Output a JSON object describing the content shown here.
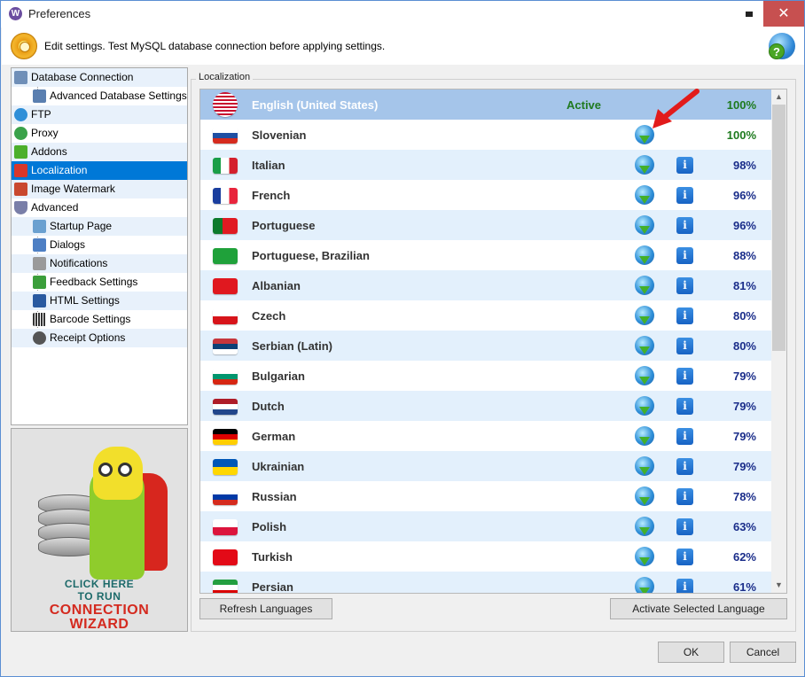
{
  "window": {
    "title": "Preferences"
  },
  "infobar": {
    "text": "Edit settings. Test MySQL database connection before applying settings."
  },
  "sidebar": {
    "items": [
      {
        "label": "Database Connection",
        "icon": "database-icon",
        "color": "#6f8fb8"
      },
      {
        "label": "Advanced Database Settings",
        "icon": "database-settings-icon",
        "color": "#5a7fb0"
      },
      {
        "label": "FTP",
        "icon": "ftp-globe-icon",
        "color": "#2f8fd8"
      },
      {
        "label": "Proxy",
        "icon": "proxy-icon",
        "color": "#3aa24a"
      },
      {
        "label": "Addons",
        "icon": "puzzle-icon",
        "color": "#4caf2a"
      },
      {
        "label": "Localization",
        "icon": "localization-flag-icon",
        "color": "#d9372a"
      },
      {
        "label": "Image Watermark",
        "icon": "image-watermark-icon",
        "color": "#c9482e"
      },
      {
        "label": "Advanced",
        "icon": "shield-icon",
        "color": "#7a7fa8"
      },
      {
        "label": "Startup Page",
        "icon": "startup-page-icon",
        "color": "#6aa0d0"
      },
      {
        "label": "Dialogs",
        "icon": "dialogs-icon",
        "color": "#4d7fc4"
      },
      {
        "label": "Notifications",
        "icon": "notifications-icon",
        "color": "#9a9a9a"
      },
      {
        "label": "Feedback Settings",
        "icon": "feedback-chart-icon",
        "color": "#3b9e3b"
      },
      {
        "label": "HTML Settings",
        "icon": "html-icon",
        "color": "#2a5aa0"
      },
      {
        "label": "Barcode Settings",
        "icon": "barcode-icon",
        "color": "#333333"
      },
      {
        "label": "Receipt Options",
        "icon": "receipt-gear-icon",
        "color": "#555555"
      }
    ]
  },
  "wizard": {
    "line1": "CLICK HERE",
    "line2": "TO RUN",
    "line3": "CONNECTION",
    "line4": "WIZARD"
  },
  "localization": {
    "group_label": "Localization",
    "languages": [
      {
        "name": "English (United States)",
        "status": "Active",
        "percent": "100%",
        "flag": "us-flag-icon",
        "has_info": false,
        "has_download": false
      },
      {
        "name": "Slovenian",
        "status": "",
        "percent": "100%",
        "flag": "slovenia-flag-icon",
        "has_info": false,
        "has_download": true
      },
      {
        "name": "Italian",
        "status": "",
        "percent": "98%",
        "flag": "italy-flag-icon",
        "has_info": true,
        "has_download": true
      },
      {
        "name": "French",
        "status": "",
        "percent": "96%",
        "flag": "france-flag-icon",
        "has_info": true,
        "has_download": true
      },
      {
        "name": "Portuguese",
        "status": "",
        "percent": "96%",
        "flag": "portugal-flag-icon",
        "has_info": true,
        "has_download": true
      },
      {
        "name": "Portuguese, Brazilian",
        "status": "",
        "percent": "88%",
        "flag": "brazil-flag-icon",
        "has_info": true,
        "has_download": true
      },
      {
        "name": "Albanian",
        "status": "",
        "percent": "81%",
        "flag": "albania-flag-icon",
        "has_info": true,
        "has_download": true
      },
      {
        "name": "Czech",
        "status": "",
        "percent": "80%",
        "flag": "czech-flag-icon",
        "has_info": true,
        "has_download": true
      },
      {
        "name": "Serbian (Latin)",
        "status": "",
        "percent": "80%",
        "flag": "serbia-flag-icon",
        "has_info": true,
        "has_download": true
      },
      {
        "name": "Bulgarian",
        "status": "",
        "percent": "79%",
        "flag": "bulgaria-flag-icon",
        "has_info": true,
        "has_download": true
      },
      {
        "name": "Dutch",
        "status": "",
        "percent": "79%",
        "flag": "netherlands-flag-icon",
        "has_info": true,
        "has_download": true
      },
      {
        "name": "German",
        "status": "",
        "percent": "79%",
        "flag": "germany-flag-icon",
        "has_info": true,
        "has_download": true
      },
      {
        "name": "Ukrainian",
        "status": "",
        "percent": "79%",
        "flag": "ukraine-flag-icon",
        "has_info": true,
        "has_download": true
      },
      {
        "name": "Russian",
        "status": "",
        "percent": "78%",
        "flag": "russia-flag-icon",
        "has_info": true,
        "has_download": true
      },
      {
        "name": "Polish",
        "status": "",
        "percent": "63%",
        "flag": "poland-flag-icon",
        "has_info": true,
        "has_download": true
      },
      {
        "name": "Turkish",
        "status": "",
        "percent": "62%",
        "flag": "turkey-flag-icon",
        "has_info": true,
        "has_download": true
      },
      {
        "name": "Persian",
        "status": "",
        "percent": "61%",
        "flag": "iran-flag-icon",
        "has_info": true,
        "has_download": true
      }
    ],
    "refresh_label": "Refresh Languages",
    "activate_label": "Activate Selected Language"
  },
  "footer": {
    "ok_label": "OK",
    "cancel_label": "Cancel"
  },
  "colors": {
    "selection": "#0078d7",
    "row_alt": "#e3f0fc",
    "active_row": "#a5c5ea",
    "percent_full": "#1d7a1d",
    "percent_partial": "#1a2d8a",
    "arrow": "#e21b1b"
  }
}
